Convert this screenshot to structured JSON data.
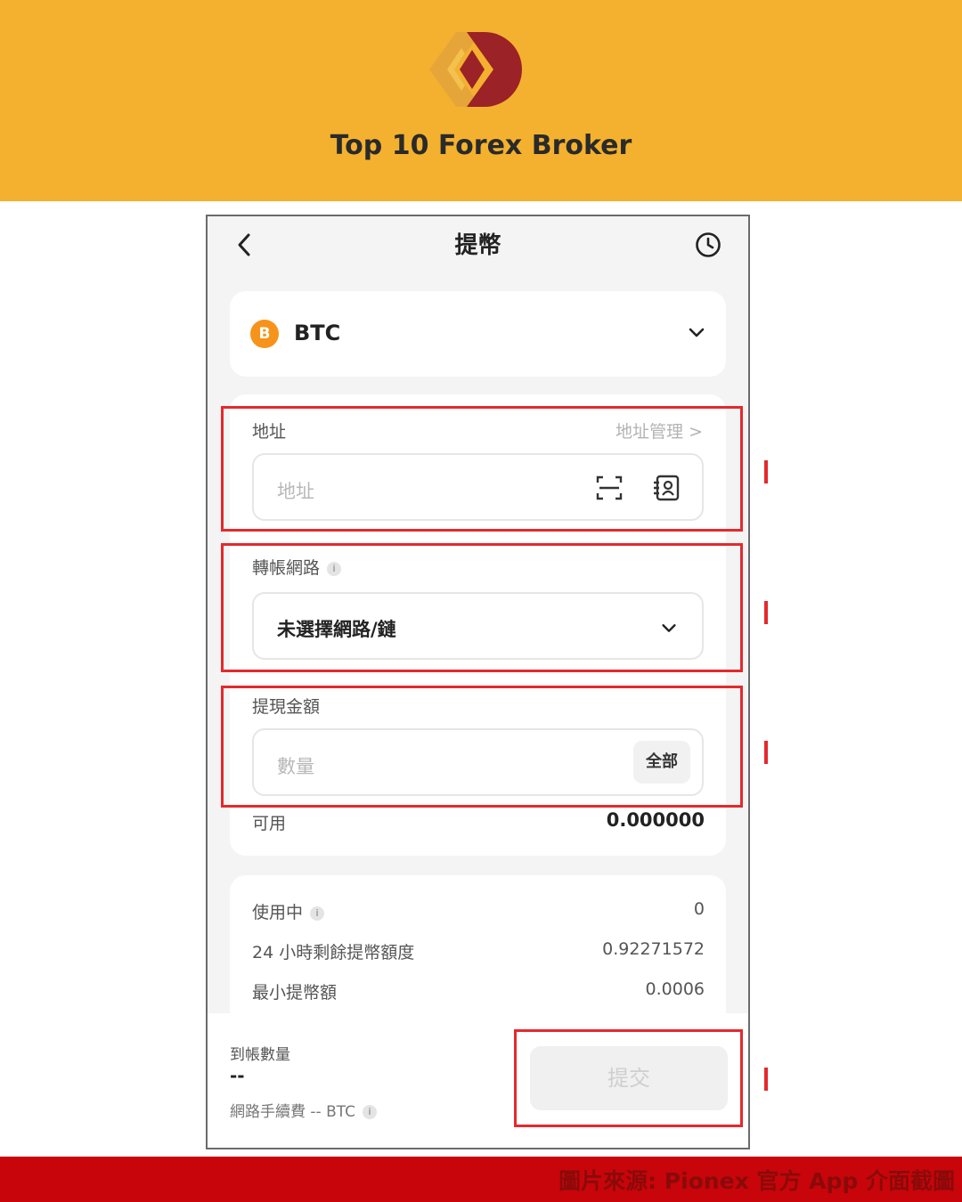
{
  "brand": {
    "name": "Top 10 Forex Broker",
    "colors": {
      "banner": "#F4B12F",
      "logo_gold": "#E2A23C",
      "logo_red": "#9B2226"
    }
  },
  "screen": {
    "title": "提幣",
    "back_icon": "chevron-left-icon",
    "history_icon": "clock-icon",
    "coin": {
      "icon_letter": "B",
      "symbol": "BTC",
      "icon_color": "#F7931A"
    },
    "address": {
      "label": "地址",
      "manage_link": "地址管理 >",
      "placeholder": "地址",
      "scan_icon": "scan-icon",
      "contacts_icon": "address-book-icon"
    },
    "network": {
      "label": "轉帳網路",
      "info_icon": "i",
      "selected": "未選擇網路/鏈"
    },
    "amount": {
      "label": "提現金額",
      "placeholder": "數量",
      "all_button": "全部"
    },
    "available": {
      "label": "可用",
      "value": "0.000000"
    },
    "limits": [
      {
        "label": "使用中",
        "has_info": true,
        "value": "0"
      },
      {
        "label": "24 小時剩餘提幣額度",
        "has_info": false,
        "value": "0.92271572"
      },
      {
        "label": "最小提幣額",
        "has_info": false,
        "value": "0.0006"
      }
    ],
    "footer": {
      "receive_label": "到帳數量",
      "receive_value": "--",
      "fee_text": "網路手續費 -- BTC",
      "submit_label": "提交"
    },
    "highlight_color": "#E4292D"
  },
  "caption": "圖片來源: Pionex 官方 App 介面截圖"
}
